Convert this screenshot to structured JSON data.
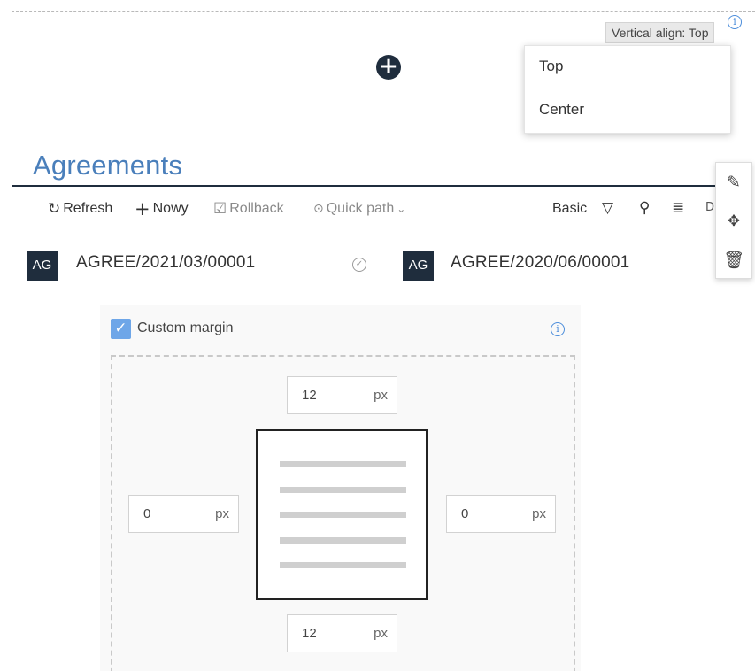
{
  "top": {
    "valign_button": "Vertical align: Top",
    "dropdown": {
      "options": [
        "Top",
        "Center"
      ]
    },
    "title": "Agreements",
    "toolbar": {
      "refresh": "Refresh",
      "new": "Nowy",
      "rollback": "Rollback",
      "quick_path": "Quick path",
      "view": "Basic"
    },
    "rows": [
      {
        "badge": "AG",
        "id": "AGREE/2021/03/00001"
      },
      {
        "badge": "AG",
        "id": "AGREE/2020/06/00001"
      }
    ],
    "side_tools": [
      "pencil-icon",
      "move-icon",
      "trash-icon"
    ]
  },
  "margin": {
    "checkbox_label": "Custom margin",
    "checked": true,
    "top": {
      "value": "12",
      "unit": "px"
    },
    "bottom": {
      "value": "12",
      "unit": "px"
    },
    "left": {
      "value": "0",
      "unit": "px"
    },
    "right": {
      "value": "0",
      "unit": "px"
    }
  },
  "colors": {
    "accent": "#4a7fbb",
    "dark": "#1f2d3d",
    "checkbox": "#6ea6e8"
  }
}
